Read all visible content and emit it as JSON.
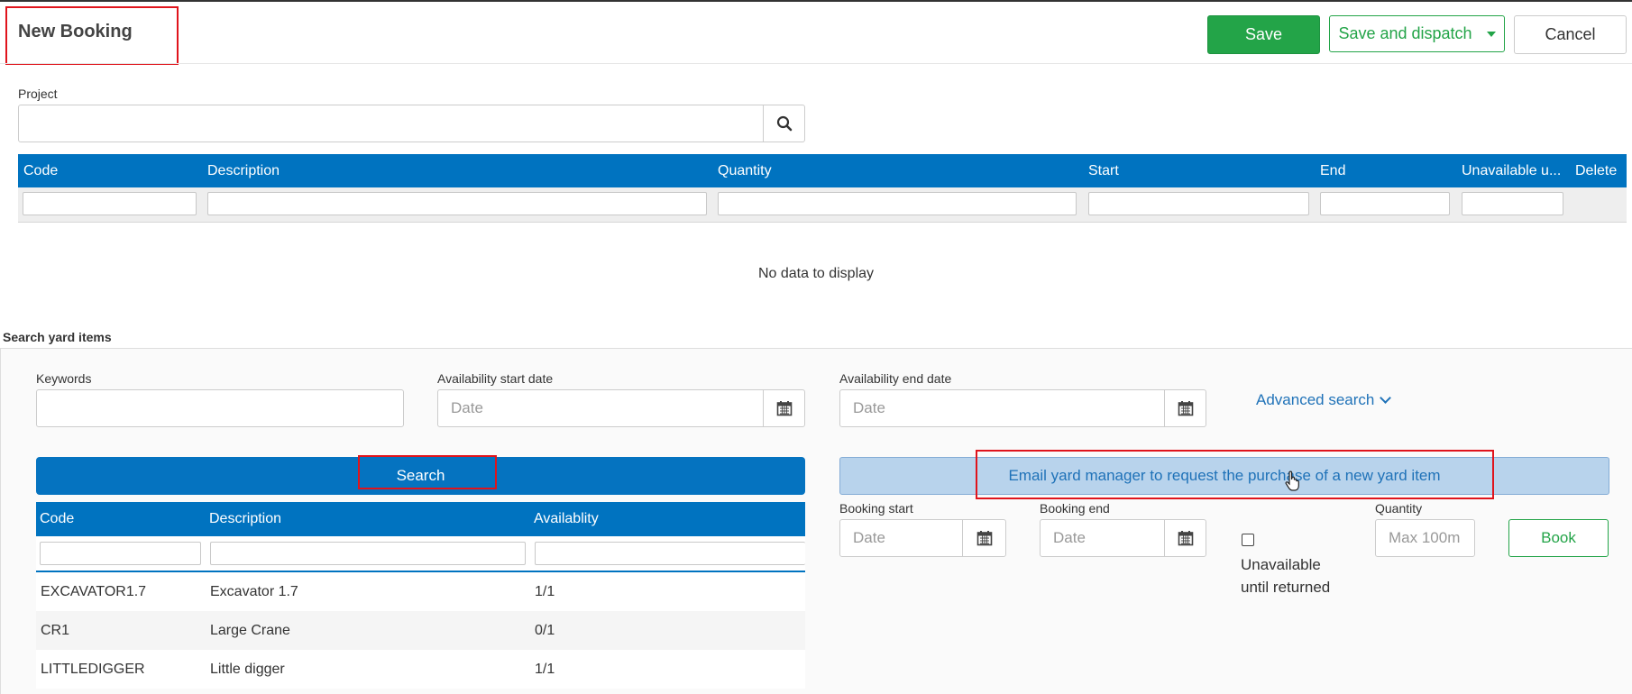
{
  "header": {
    "title": "New Booking",
    "save_label": "Save",
    "save_dispatch_label": "Save and dispatch",
    "cancel_label": "Cancel"
  },
  "project": {
    "label": "Project",
    "value": "",
    "search_icon": "search-icon"
  },
  "booking_grid": {
    "columns": [
      "Code",
      "Description",
      "Quantity",
      "Start",
      "End",
      "Unavailable u...",
      "Delete"
    ],
    "empty_text": "No data to display"
  },
  "search_yard": {
    "title": "Search yard items",
    "keywords_label": "Keywords",
    "keywords_value": "",
    "start_date_label": "Availability start date",
    "start_date_placeholder": "Date",
    "end_date_label": "Availability end date",
    "end_date_placeholder": "Date",
    "advanced_search_label": "Advanced search",
    "search_button": "Search",
    "email_button": "Email yard manager to request the purchase of a new yard item"
  },
  "items_grid": {
    "columns": [
      "Code",
      "Description",
      "Availablity"
    ],
    "rows": [
      {
        "code": "EXCAVATOR1.7",
        "description": "Excavator 1.7",
        "availability": "1/1"
      },
      {
        "code": "CR1",
        "description": "Large Crane",
        "availability": "0/1"
      },
      {
        "code": "LITTLEDIGGER",
        "description": "Little digger",
        "availability": "1/1"
      }
    ]
  },
  "booking_form": {
    "start_label": "Booking start",
    "start_placeholder": "Date",
    "end_label": "Booking end",
    "end_placeholder": "Date",
    "unavailable_label_line1": "Unavailable",
    "unavailable_label_line2": "until returned",
    "unavailable_checked": false,
    "quantity_label": "Quantity",
    "quantity_placeholder": "Max 100m",
    "book_button": "Book"
  },
  "colors": {
    "primary_blue": "#0073c0",
    "success_green": "#23a448",
    "highlight_red": "#e0141c",
    "email_bg": "#b8d3ec"
  }
}
